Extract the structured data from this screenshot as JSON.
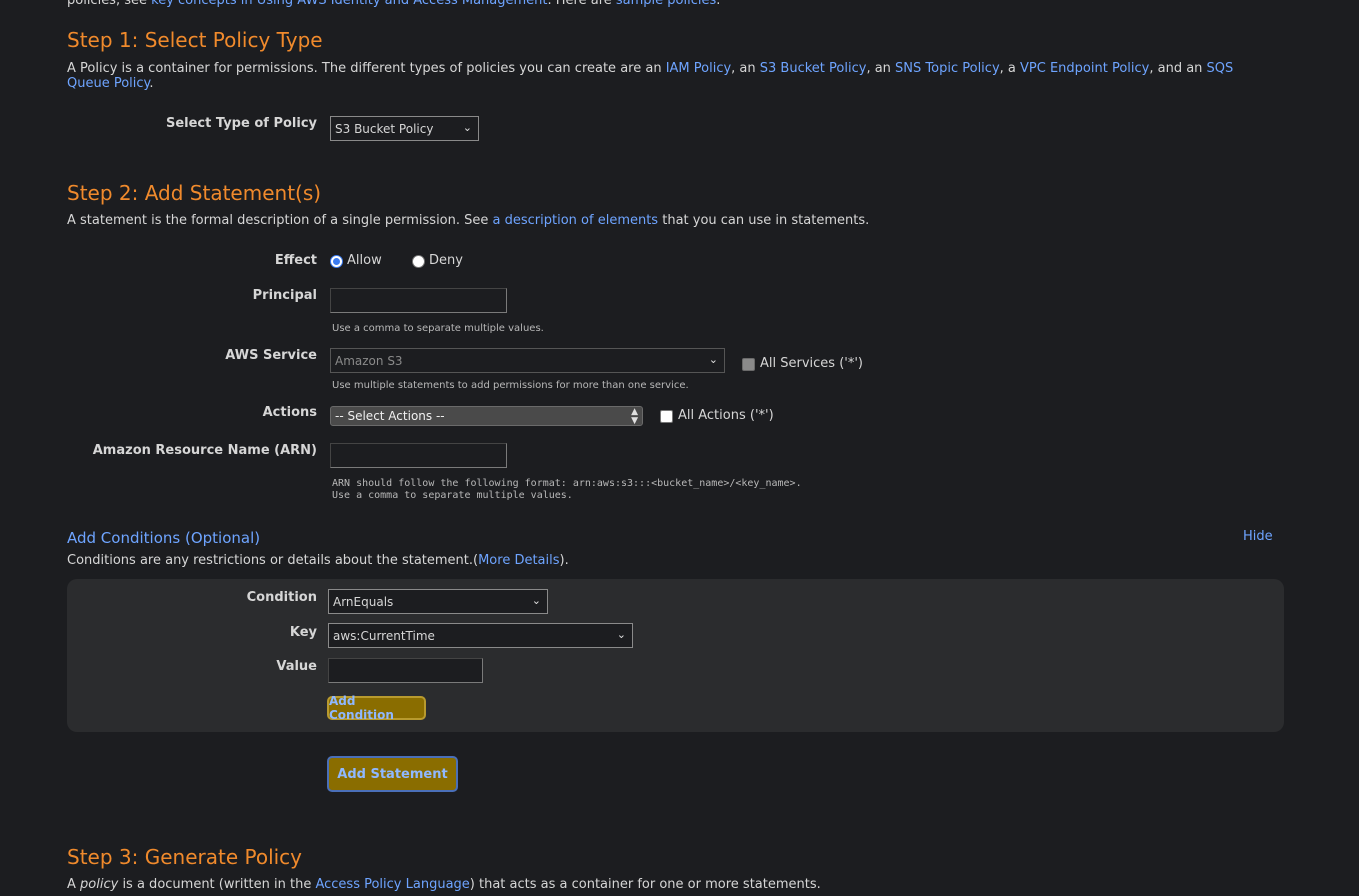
{
  "intro": {
    "prefix": "policies, see ",
    "link1": "key concepts in Using AWS Identity and Access Management",
    "middle": ". Here are ",
    "link2": "sample policies",
    "suffix": "."
  },
  "step1": {
    "title": "Step 1: Select Policy Type",
    "desc_prefix": "A Policy is a container for permissions. The different types of policies you can create are an ",
    "link_iam": "IAM Policy",
    "sep1": ", an ",
    "link_s3": "S3 Bucket Policy",
    "sep2": ", an ",
    "link_sns": "SNS Topic Policy",
    "sep3": ", a ",
    "link_vpc": "VPC Endpoint Policy",
    "sep4": ", and an ",
    "link_sqs": "SQS Queue Policy",
    "desc_suffix": ".",
    "type_label": "Select Type of Policy",
    "type_value": "S3 Bucket Policy"
  },
  "step2": {
    "title": "Step 2: Add Statement(s)",
    "desc_prefix": "A statement is the formal description of a single permission. See ",
    "desc_link": "a description of elements",
    "desc_suffix": " that you can use in statements.",
    "effect_label": "Effect",
    "effect_allow": "Allow",
    "effect_deny": "Deny",
    "principal_label": "Principal",
    "principal_value": "",
    "principal_hint": "Use a comma to separate multiple values.",
    "service_label": "AWS Service",
    "service_value": "Amazon S3",
    "all_services": "All Services ('*')",
    "service_hint": "Use multiple statements to add permissions for more than one service.",
    "actions_label": "Actions",
    "actions_value": "-- Select Actions --",
    "all_actions": "All Actions ('*')",
    "arn_label": "Amazon Resource Name (ARN)",
    "arn_value": "",
    "arn_hint1": "ARN should follow the following format: arn:aws:s3:::<bucket_name>/<key_name>.",
    "arn_hint2": "Use a comma to separate multiple values."
  },
  "conditions": {
    "title": "Add Conditions (Optional)",
    "hide": "Hide",
    "desc_prefix": "Conditions are any restrictions or details about the statement.(",
    "desc_link": "More Details",
    "desc_suffix": ").",
    "condition_label": "Condition",
    "condition_value": "ArnEquals",
    "key_label": "Key",
    "key_value": "aws:CurrentTime",
    "value_label": "Value",
    "value_value": "",
    "add_condition": "Add Condition"
  },
  "add_statement": "Add Statement",
  "step3": {
    "title": "Step 3: Generate Policy",
    "desc_a": "A ",
    "desc_em": "policy",
    "desc_b": " is a document (written in the ",
    "desc_link": "Access Policy Language",
    "desc_c": ") that acts as a container for one or more statements."
  },
  "icons": {
    "chevron": "chevron-down-icon",
    "updown": "updown-arrows-icon"
  }
}
